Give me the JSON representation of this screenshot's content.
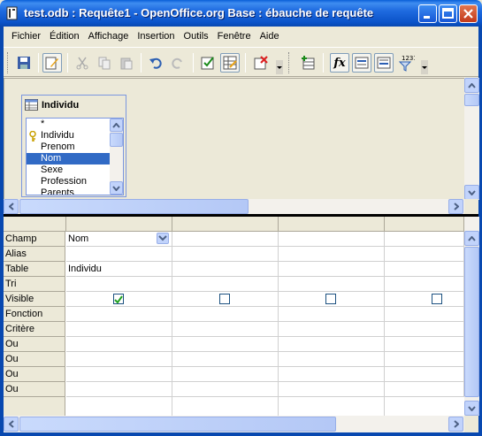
{
  "window": {
    "title": "test.odb : Requête1 - OpenOffice.org Base : ébauche de requête"
  },
  "menu": {
    "items": [
      "Fichier",
      "Édition",
      "Affichage",
      "Insertion",
      "Outils",
      "Fenêtre",
      "Aide"
    ]
  },
  "toolbar": {
    "tools": [
      "save-icon",
      "edit-mode-icon",
      "cut-icon",
      "copy-icon",
      "paste-icon",
      "undo-icon",
      "redo-icon",
      "run-query-icon",
      "clear-query-icon",
      "design-view-icon",
      "delete-icon",
      "add-table-icon",
      "functions-icon",
      "table-name-icon",
      "alias-icon",
      "distinct-values-icon"
    ],
    "functions_label": "fx",
    "distinct_label": "1231"
  },
  "table_window": {
    "title": "Individu",
    "fields": [
      "*",
      "Individu",
      "Prenom",
      "Nom",
      "Sexe",
      "Profession",
      "Parents"
    ],
    "selected_field": "Nom",
    "key_field": "Individu"
  },
  "grid": {
    "row_labels": [
      "Champ",
      "Alias",
      "Table",
      "Tri",
      "Visible",
      "Fonction",
      "Critère",
      "Ou",
      "Ou",
      "Ou",
      "Ou"
    ],
    "columns": [
      {
        "champ": "Nom",
        "alias": "",
        "table": "Individu",
        "tri": "",
        "visible": true,
        "fonction": "",
        "critere": ""
      },
      {
        "champ": "",
        "alias": "",
        "table": "",
        "tri": "",
        "visible": false,
        "fonction": "",
        "critere": ""
      },
      {
        "champ": "",
        "alias": "",
        "table": "",
        "tri": "",
        "visible": false,
        "fonction": "",
        "critere": ""
      },
      {
        "champ": "",
        "alias": "",
        "table": "",
        "tri": "",
        "visible": false,
        "fonction": "",
        "critere": ""
      }
    ]
  },
  "colors": {
    "title_bar": "#0A52C8",
    "selection": "#316AC5",
    "window_bg": "#ECE9D8"
  }
}
